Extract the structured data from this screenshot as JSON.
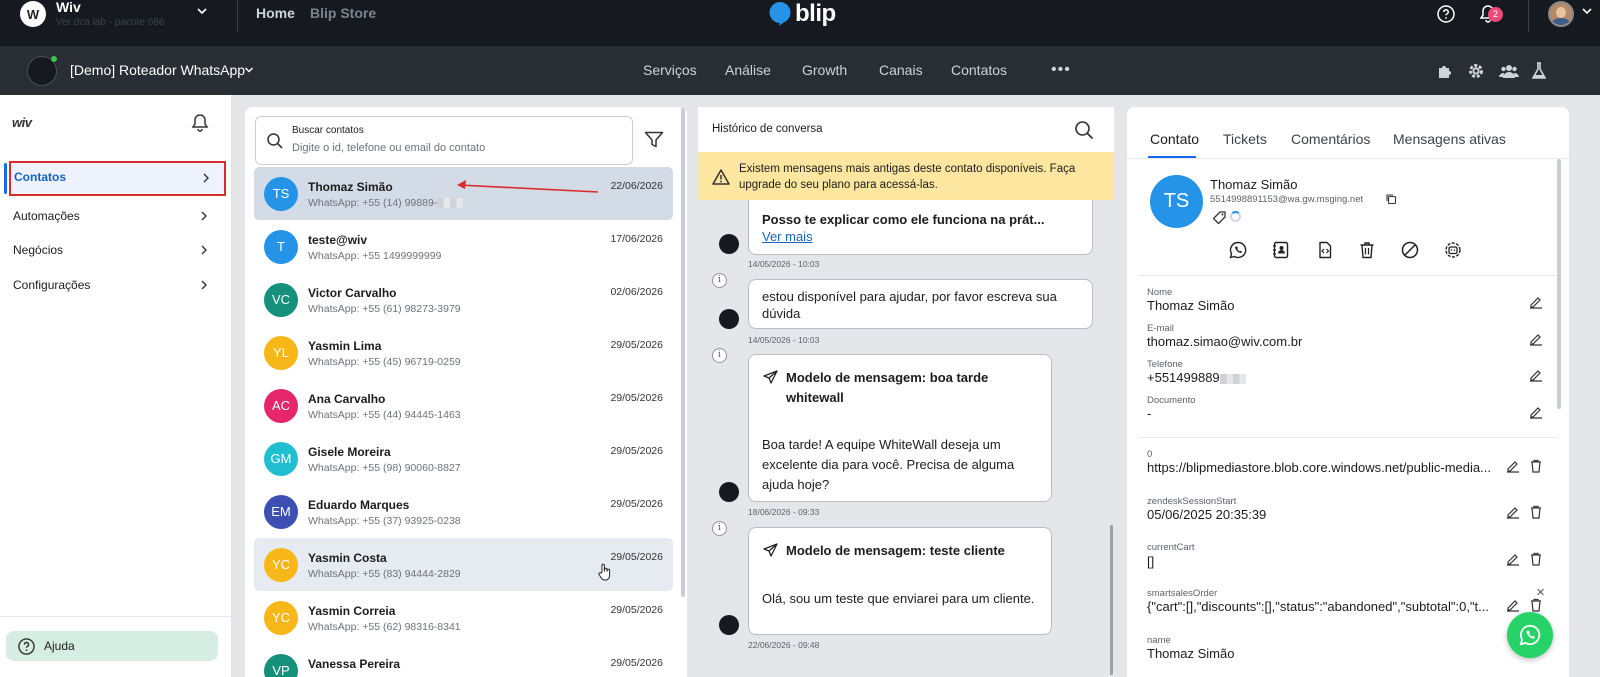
{
  "topbar": {
    "workspace_initial": "W",
    "workspace_name": "Wiv",
    "workspace_sub": "Ver dca lab - pacote 666",
    "nav_home": "Home",
    "nav_store": "Blip Store",
    "brand": "blip",
    "notification_count": "2"
  },
  "botbar": {
    "bot_name": "[Demo] Roteador WhatsApp",
    "nav": [
      "Serviços",
      "Análise",
      "Growth",
      "Canais",
      "Contatos"
    ],
    "more": "•••"
  },
  "sidebar": {
    "logo": "wiv",
    "items": [
      {
        "label": "Contatos",
        "active": true
      },
      {
        "label": "Automações"
      },
      {
        "label": "Negócios"
      },
      {
        "label": "Configurações"
      }
    ],
    "help": "Ajuda"
  },
  "contacts": {
    "search_label": "Buscar contatos",
    "search_placeholder": "Digite o id, telefone ou email do contato",
    "list": [
      {
        "initials": "TS",
        "name": "Thomaz Simão",
        "phone": "WhatsApp: +55 (14) 99889-",
        "date": "22/06/2026",
        "color": "#2594e8",
        "selected": true
      },
      {
        "initials": "T",
        "name": "teste@wiv",
        "phone": "WhatsApp: +55 1499999999",
        "date": "17/06/2026",
        "color": "#2594e8"
      },
      {
        "initials": "VC",
        "name": "Victor Carvalho",
        "phone": "WhatsApp: +55 (61) 98273-3979",
        "date": "02/06/2026",
        "color": "#15907a"
      },
      {
        "initials": "YL",
        "name": "Yasmin Lima",
        "phone": "WhatsApp: +55 (45) 96719-0259",
        "date": "29/05/2026",
        "color": "#f7b719"
      },
      {
        "initials": "AC",
        "name": "Ana Carvalho",
        "phone": "WhatsApp: +55 (44) 94445-1463",
        "date": "29/05/2026",
        "color": "#e5276a"
      },
      {
        "initials": "GM",
        "name": "Gisele Moreira",
        "phone": "WhatsApp: +55 (98) 90060-8827",
        "date": "29/05/2026",
        "color": "#1fbfd0"
      },
      {
        "initials": "EM",
        "name": "Eduardo Marques",
        "phone": "WhatsApp: +55 (37) 93925-0238",
        "date": "29/05/2026",
        "color": "#3c4fb3"
      },
      {
        "initials": "YC",
        "name": "Yasmin Costa",
        "phone": "WhatsApp: +55 (83) 94444-2829",
        "date": "29/05/2026",
        "color": "#f7b719",
        "hover": true
      },
      {
        "initials": "YC",
        "name": "Yasmin Correia",
        "phone": "WhatsApp: +55 (62) 98316-8341",
        "date": "29/05/2026",
        "color": "#f7b719"
      },
      {
        "initials": "VP",
        "name": "Vanessa Pereira",
        "phone": "",
        "date": "29/05/2026",
        "color": "#15907a"
      }
    ]
  },
  "history": {
    "title": "Histórico de conversa",
    "warning": "Existem mensagens mais antigas deste contato disponíveis. Faça upgrade do seu plano para acessá-las.",
    "messages": [
      {
        "text": "Posso te explicar como ele funciona na prát...",
        "link": "Ver mais",
        "time": "14/05/2026 - 10:03"
      },
      {
        "text": "estou disponível para ajudar, por favor escreva sua dúvida",
        "time": "14/05/2026 - 10:03"
      },
      {
        "template_title": "Modelo de mensagem: boa tarde whitewall",
        "text": "Boa tarde! A equipe WhiteWall deseja um excelente dia para você. Precisa de alguma ajuda hoje?",
        "time": "18/06/2026 - 09:33"
      },
      {
        "template_title": "Modelo de mensagem: teste cliente",
        "text": "Olá, sou um teste que enviarei para um cliente.",
        "time": "22/06/2026 - 09:48"
      }
    ]
  },
  "details": {
    "tabs": [
      "Contato",
      "Tickets",
      "Comentários",
      "Mensagens ativas"
    ],
    "initials": "TS",
    "name": "Thomaz Simão",
    "id": "5514998891153@wa.gw.msging.net",
    "fields": [
      {
        "label": "Nome",
        "value": "Thomaz Simão"
      },
      {
        "label": "E-mail",
        "value": "thomaz.simao@wiv.com.br"
      },
      {
        "label": "Telefone",
        "value": "+551499889"
      },
      {
        "label": "Documento",
        "value": "-"
      }
    ],
    "extras": [
      {
        "label": "0",
        "value": "https://blipmediastore.blob.core.windows.net/public-media..."
      },
      {
        "label": "zendeskSessionStart",
        "value": "05/06/2025 20:35:39"
      },
      {
        "label": "currentCart",
        "value": "[]"
      },
      {
        "label": "smartsalesOrder",
        "value": "{\"cart\":[],\"discounts\":[],\"status\":\"abandoned\",\"subtotal\":0,\"t..."
      },
      {
        "label": "name",
        "value": "Thomaz Simão"
      }
    ]
  },
  "colors": {
    "accent": "#1968f0",
    "highlight_border": "#d92d2d",
    "warning_bg": "#fde7a0",
    "whatsapp": "#25d366"
  }
}
